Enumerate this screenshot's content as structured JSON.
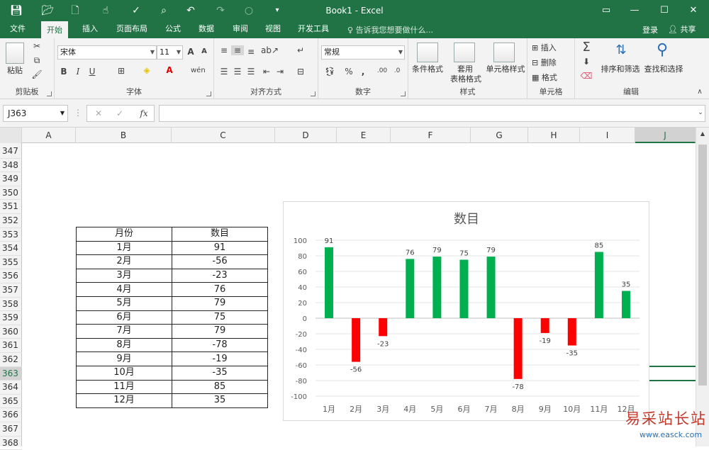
{
  "window": {
    "title": "Book1 - Excel",
    "controls": {
      "restore": "▭",
      "minimize": "—",
      "maximize": "☐",
      "close": "✕"
    }
  },
  "quick_access": {
    "save_icon": "save-icon",
    "open_icon": "folder-icon",
    "new_icon": "new-file-icon",
    "touch_icon": "touch-mode-icon",
    "spell_icon": "spell-check-icon",
    "preview_icon": "print-preview-icon",
    "undo_icon": "undo-icon",
    "redo_icon": "redo-icon"
  },
  "tabs": [
    "文件",
    "开始",
    "插入",
    "页面布局",
    "公式",
    "数据",
    "审阅",
    "视图",
    "开发工具"
  ],
  "active_tab": "开始",
  "tell_me": "告诉我您想要做什么...",
  "login": "登录",
  "share": "共享",
  "ribbon": {
    "clipboard": {
      "label": "剪贴板",
      "paste": "粘贴"
    },
    "font": {
      "label": "字体",
      "name": "宋体",
      "size": "11",
      "bold": "B",
      "italic": "I",
      "underline": "U",
      "grow": "A",
      "shrink": "A"
    },
    "alignment": {
      "label": "对齐方式"
    },
    "number": {
      "label": "数字",
      "format": "常规",
      "percent": "%",
      "comma": ","
    },
    "styles": {
      "label": "样式",
      "conditional": "条件格式",
      "table_fmt_1": "套用",
      "table_fmt_2": "表格格式",
      "cell_styles": "单元格样式"
    },
    "cells": {
      "label": "单元格",
      "insert": "插入",
      "delete": "删除",
      "format": "格式"
    },
    "editing": {
      "label": "编辑",
      "sort": "排序和筛选",
      "find": "查找和选择"
    }
  },
  "formula_bar": {
    "namebox": "J363",
    "fx": "fx",
    "formula": ""
  },
  "columns": [
    {
      "name": "A",
      "selected": false
    },
    {
      "name": "B",
      "selected": false
    },
    {
      "name": "C",
      "selected": false
    },
    {
      "name": "D",
      "selected": false
    },
    {
      "name": "E",
      "selected": false
    },
    {
      "name": "F",
      "selected": false
    },
    {
      "name": "G",
      "selected": false
    },
    {
      "name": "H",
      "selected": false
    },
    {
      "name": "I",
      "selected": false
    },
    {
      "name": "J",
      "selected": true
    }
  ],
  "rows": [
    "347",
    "348",
    "349",
    "350",
    "351",
    "352",
    "353",
    "354",
    "355",
    "356",
    "357",
    "358",
    "359",
    "360",
    "361",
    "362",
    "363",
    "364",
    "365",
    "366",
    "367",
    "368"
  ],
  "selected_row": "363",
  "table": {
    "headers": [
      "月份",
      "数目"
    ],
    "rows": [
      [
        "1月",
        "91"
      ],
      [
        "2月",
        "-56"
      ],
      [
        "3月",
        "-23"
      ],
      [
        "4月",
        "76"
      ],
      [
        "5月",
        "79"
      ],
      [
        "6月",
        "75"
      ],
      [
        "7月",
        "79"
      ],
      [
        "8月",
        "-78"
      ],
      [
        "9月",
        "-19"
      ],
      [
        "10月",
        "-35"
      ],
      [
        "11月",
        "85"
      ],
      [
        "12月",
        "35"
      ]
    ]
  },
  "chart_data": {
    "type": "bar",
    "title": "数目",
    "categories": [
      "1月",
      "2月",
      "3月",
      "4月",
      "5月",
      "6月",
      "7月",
      "8月",
      "9月",
      "10月",
      "11月",
      "12月"
    ],
    "values": [
      91,
      -56,
      -23,
      76,
      79,
      75,
      79,
      -78,
      -19,
      -35,
      85,
      35
    ],
    "ylim": [
      -100,
      100
    ],
    "yticks": [
      100,
      80,
      60,
      40,
      20,
      0,
      -20,
      -40,
      -60,
      -80,
      -100
    ],
    "grid": true,
    "legend": "none",
    "colors": {
      "positive": "#00b050",
      "negative": "#ff0000"
    }
  },
  "watermark": {
    "cn": "易采站长站",
    "en": "www.easck.com"
  }
}
